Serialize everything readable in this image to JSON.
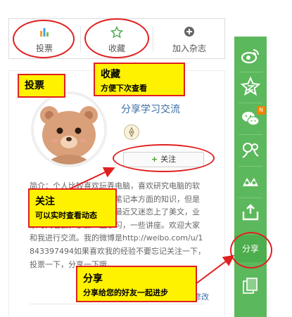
{
  "toolbar": {
    "vote_label": "投票",
    "favorite_label": "收藏",
    "magazine_label": "加入杂志"
  },
  "profile": {
    "name": "分享学习交流",
    "follow_label": "关注",
    "bio": "简介：个人比较喜欢玩弄电脑，喜欢研究电脑的软硬件系统，以前写了很多笔记本方面的知识，但是后来觉得太枯燥了，所以最近又迷恋上了美文，业余时间也会，参加一些学习，一些讲座。欢迎大家和我进行交流。我的微博是http://weibo.com/u/1843397494如果喜欢我的经验不要忘记关注一下，投票一下，分享一下哦。",
    "edit_label": "修改"
  },
  "sidebar": {
    "share_label": "分享",
    "badge_text": "N",
    "icons": [
      "weibo-icon",
      "qzone-icon",
      "wechat-icon",
      "renren-icon",
      "douban-icon",
      "share-upload-icon",
      "copy-icon"
    ]
  },
  "annotations": {
    "vote": {
      "title": "投票"
    },
    "favorite": {
      "title": "收藏",
      "subtitle": "方便下次查看"
    },
    "follow": {
      "title": "关注",
      "subtitle": "可以实时查看动态"
    },
    "share": {
      "title": "分享",
      "subtitle": "分享给您的好友一起进步"
    }
  },
  "colors": {
    "sidebar_green": "#5cb85c",
    "annotation_red": "#e02020",
    "callout_yellow": "#fff200",
    "link_blue": "#3a6ea5"
  }
}
